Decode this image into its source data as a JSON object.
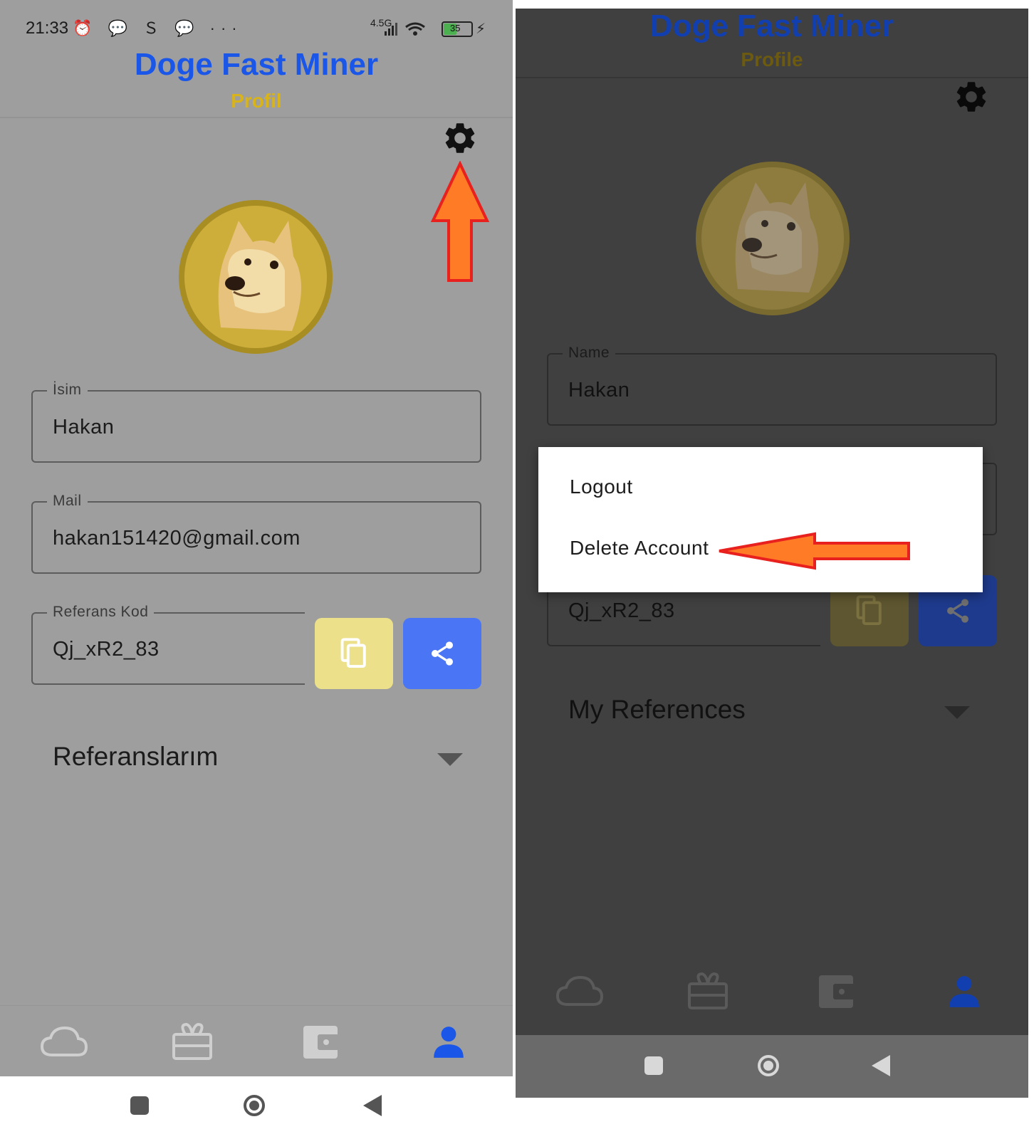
{
  "left_screen": {
    "status_bar": {
      "time": "21:33",
      "icons": "⏰ 💬 Ｓ 💬 ···",
      "network": "4.5G",
      "battery": "35"
    },
    "header": {
      "title": "Doge Fast Miner",
      "subtitle": "Profil"
    },
    "fields": {
      "name": {
        "label": "İsim",
        "value": "Hakan"
      },
      "mail": {
        "label": "Mail",
        "value": "hakan151420@gmail.com"
      },
      "referral": {
        "label": "Referans Kod",
        "value": "Qj_xR2_83"
      }
    },
    "references_title": "Referanslarım",
    "nav": [
      "cloud-icon",
      "gift-icon",
      "wallet-icon",
      "person-icon"
    ]
  },
  "right_screen": {
    "header": {
      "title": "Doge Fast Miner",
      "subtitle": "Profile"
    },
    "fields": {
      "name": {
        "label": "Name",
        "value": "Hakan"
      },
      "referral": {
        "value": "Qj_xR2_83"
      }
    },
    "menu": {
      "logout": "Logout",
      "delete_account": "Delete Account"
    },
    "references_title": "My References",
    "nav": [
      "cloud-icon",
      "gift-icon",
      "wallet-icon",
      "person-icon"
    ]
  },
  "colors": {
    "brand_blue": "#1a56e8",
    "subtitle_yellow": "#d8b31a",
    "copy_button": "#ece08a",
    "share_button": "#4a76f5",
    "active_nav": "#1a56e8",
    "annotation_arrow": "#ff7b26"
  }
}
